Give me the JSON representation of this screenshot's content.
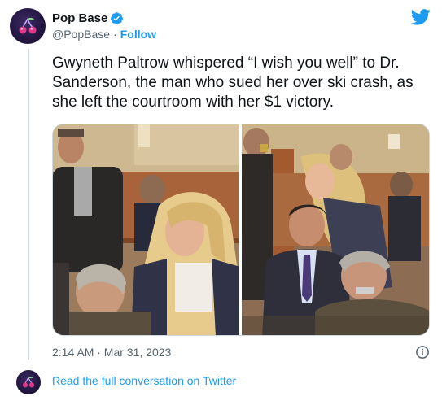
{
  "author": {
    "display_name": "Pop Base",
    "handle": "@PopBase",
    "separator": "·",
    "follow_label": "Follow"
  },
  "tweet": {
    "text": "Gwyneth Paltrow whispered “I wish you well” to Dr. Sanderson, the man who sued her over ski crash, as she left the courtroom with her $1 victory.",
    "timestamp": "2:14 AM · Mar 31, 2023"
  },
  "footer": {
    "read_label": "Read the full conversation on Twitter"
  },
  "colors": {
    "accent": "#1d9bf0",
    "text": "#0f1419",
    "muted": "#536471",
    "border": "#cfd9de"
  },
  "icons": {
    "verified": "verified-badge-icon",
    "brand": "twitter-bird-icon",
    "info": "info-icon"
  }
}
